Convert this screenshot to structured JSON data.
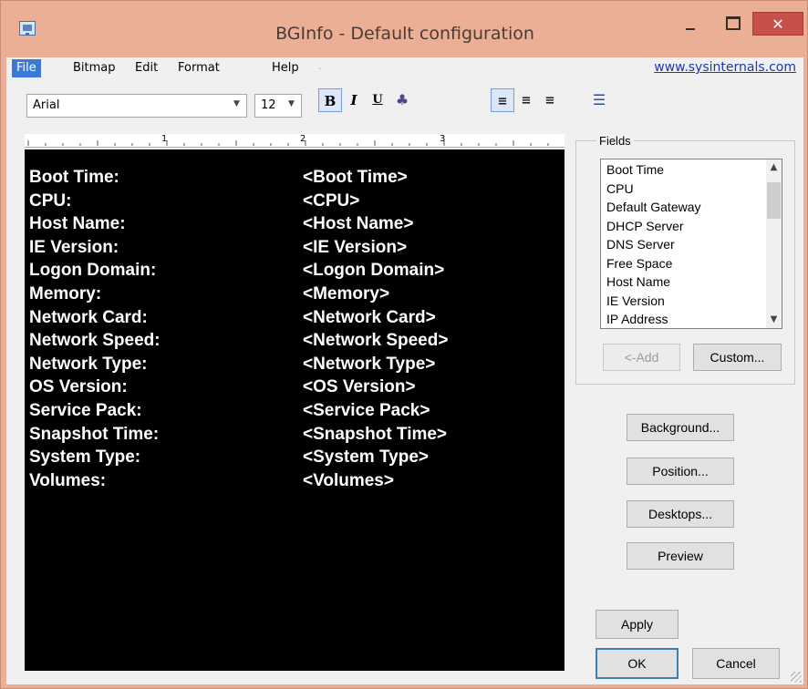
{
  "window": {
    "title": "BGInfo - Default configuration",
    "close_glyph": "✕"
  },
  "menu": {
    "items": [
      "File",
      "Bitmap",
      "Edit",
      "Format",
      "Help"
    ],
    "link": "www.sysinternals.com"
  },
  "toolbar": {
    "font": "Arial",
    "size": "12",
    "bold": "B",
    "italic": "I",
    "underline": "U",
    "color": "♣",
    "align_left": "≡",
    "align_center": "≡",
    "align_right": "≡",
    "list": "☰"
  },
  "ruler": {
    "numbers": [
      "1",
      "2",
      "3"
    ]
  },
  "editor": {
    "rows": [
      {
        "label": "Boot Time:",
        "value": "<Boot Time>"
      },
      {
        "label": "CPU:",
        "value": "<CPU>"
      },
      {
        "label": "Host Name:",
        "value": "<Host Name>"
      },
      {
        "label": "IE Version:",
        "value": "<IE Version>"
      },
      {
        "label": "Logon Domain:",
        "value": "<Logon Domain>"
      },
      {
        "label": "Memory:",
        "value": "<Memory>"
      },
      {
        "label": "Network Card:",
        "value": "<Network Card>"
      },
      {
        "label": "Network Speed:",
        "value": "<Network Speed>"
      },
      {
        "label": "Network Type:",
        "value": "<Network Type>"
      },
      {
        "label": "OS Version:",
        "value": "<OS Version>"
      },
      {
        "label": "Service Pack:",
        "value": "<Service Pack>"
      },
      {
        "label": "Snapshot Time:",
        "value": "<Snapshot Time>"
      },
      {
        "label": "System Type:",
        "value": "<System Type>"
      },
      {
        "label": "Volumes:",
        "value": "<Volumes>"
      }
    ]
  },
  "fields": {
    "legend": "Fields",
    "items": [
      "Boot Time",
      "CPU",
      "Default Gateway",
      "DHCP Server",
      "DNS Server",
      "Free Space",
      "Host Name",
      "IE Version",
      "IP Address"
    ],
    "add_label": "<-Add",
    "custom_label": "Custom..."
  },
  "buttons": {
    "background": "Background...",
    "position": "Position...",
    "desktops": "Desktops...",
    "preview": "Preview",
    "apply": "Apply",
    "ok": "OK",
    "cancel": "Cancel"
  }
}
